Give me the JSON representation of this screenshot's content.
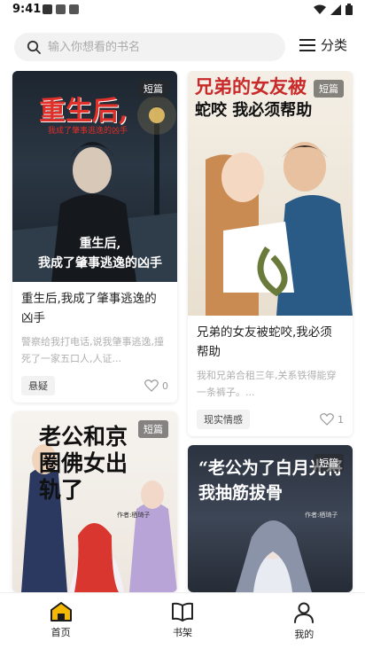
{
  "status": {
    "time": "9:41"
  },
  "header": {
    "search_placeholder": "输入你想看的书名",
    "category_label": "分类"
  },
  "colors": {
    "accent": "#f5b800"
  },
  "books": [
    {
      "cover_title": "重生后,",
      "cover_subtitle": "我成了肇事逃逸的凶手",
      "cover_caption": "重生后,\n我成了肇事逃逸的凶手",
      "badge": "短篇",
      "title": "重生后,我成了肇事逃逸的凶手",
      "desc": "警察给我打电话,说我肇事逃逸,撞死了一家五口人,人证...",
      "tag": "悬疑",
      "likes": "0"
    },
    {
      "cover_title": "兄弟的女友被",
      "cover_subtitle": "蛇咬 我必须帮助",
      "badge": "短篇",
      "title": "兄弟的女友被蛇咬,我必须帮助",
      "desc": "我和兄弟合租三年,关系铁得能穿一条裤子。...",
      "tag": "现实情感",
      "likes": "1"
    },
    {
      "cover_title": "老公和京圈佛女出轨了",
      "cover_author": "作者:栖琦子",
      "badge": "短篇"
    },
    {
      "cover_title": "“老公为了白月光将我抽筋拔骨",
      "cover_author": "作者:栖琦子",
      "badge": "短篇"
    }
  ],
  "nav": {
    "home": "首页",
    "shelf": "书架",
    "mine": "我的"
  }
}
